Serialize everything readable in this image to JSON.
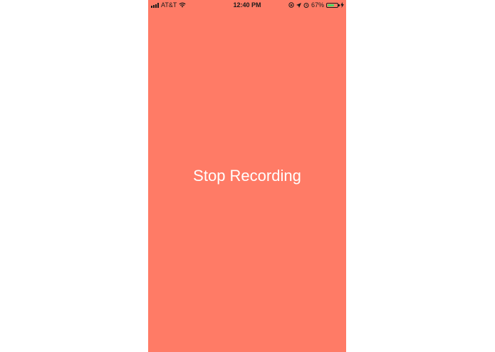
{
  "status_bar": {
    "carrier": "AT&T",
    "time": "12:40 PM",
    "battery_percent_label": "67%",
    "battery_level": 0.67,
    "icons": [
      "signal-bars-icon",
      "wifi-icon",
      "screen-lock-rotation-icon",
      "location-arrow-icon",
      "alarm-icon",
      "battery-icon",
      "charging-bolt-icon"
    ]
  },
  "main": {
    "stop_label": "Stop Recording",
    "background_color": "#ff7b66",
    "text_color": "#ffffff"
  }
}
